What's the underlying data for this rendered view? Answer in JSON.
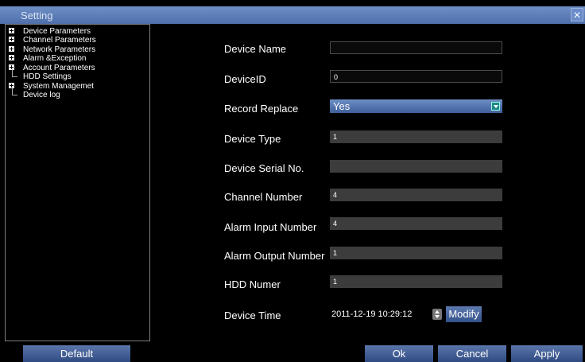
{
  "window": {
    "title": "Setting",
    "close_icon": "close-icon"
  },
  "tree": {
    "items": [
      {
        "label": "Device Parameters",
        "expandable": true
      },
      {
        "label": "Channel Parameters",
        "expandable": true
      },
      {
        "label": "Network Parameters",
        "expandable": true
      },
      {
        "label": "Alarm &Exception",
        "expandable": true
      },
      {
        "label": "Account Parameters",
        "expandable": true
      },
      {
        "label": "HDD Settings",
        "expandable": false
      },
      {
        "label": "System Managemet",
        "expandable": true
      },
      {
        "label": "Device log",
        "expandable": false
      }
    ]
  },
  "form": {
    "device_name": {
      "label": "Device Name",
      "value": ""
    },
    "device_id": {
      "label": "DeviceID",
      "value": "0"
    },
    "record_replace": {
      "label": "Record Replace",
      "value": "Yes"
    },
    "device_type": {
      "label": "Device Type",
      "value": "1"
    },
    "device_serial": {
      "label": "Device Serial No.",
      "value": ""
    },
    "channel_number": {
      "label": "Channel Number",
      "value": "4"
    },
    "alarm_input_number": {
      "label": "Alarm Input Number",
      "value": "4"
    },
    "alarm_output_number": {
      "label": "Alarm Output Number",
      "value": "1"
    },
    "hdd_number": {
      "label": "HDD Numer",
      "value": "1"
    },
    "device_time": {
      "label": "Device Time",
      "value": "2011-12-19 10:29:12",
      "modify_label": "Modify"
    }
  },
  "footer": {
    "default_label": "Default",
    "ok_label": "Ok",
    "cancel_label": "Cancel",
    "apply_label": "Apply"
  },
  "colors": {
    "title_bar": "#5a7bbd",
    "button": "#4a66a0",
    "field_bg": "#3c3c3c"
  }
}
